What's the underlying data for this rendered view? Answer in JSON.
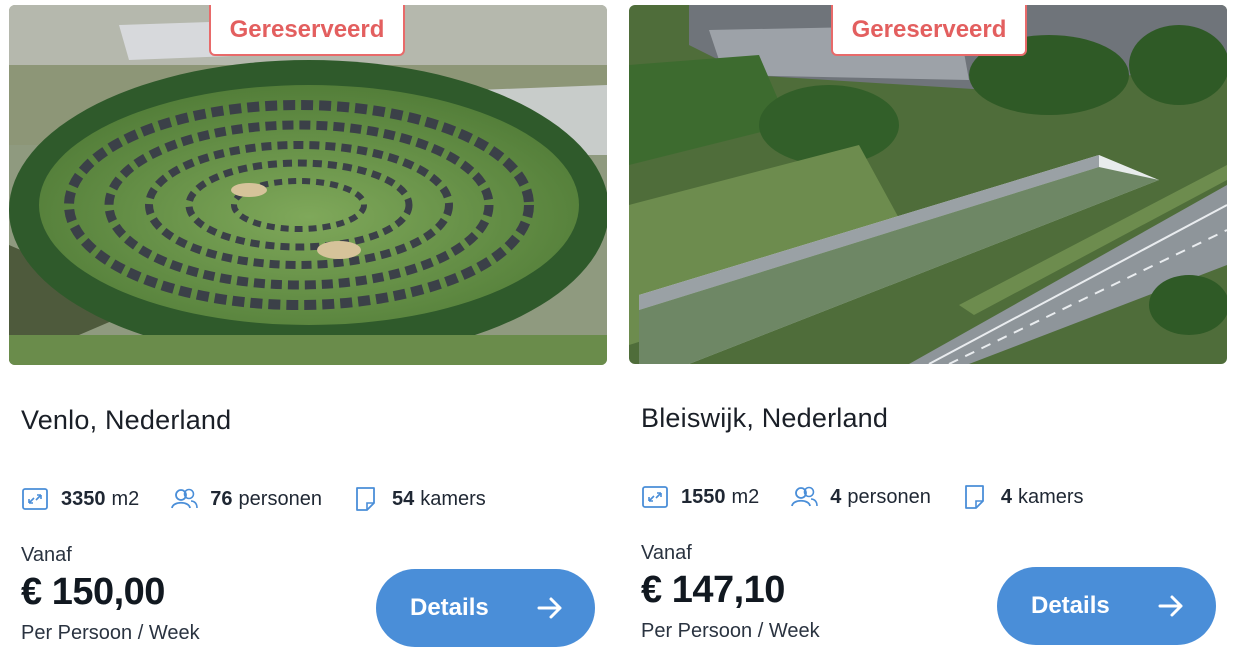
{
  "colors": {
    "accent": "#4a8ed8",
    "badge_red": "#e35f5f",
    "icon_blue": "#4a8ed8"
  },
  "listings": [
    {
      "status_badge": "Gereserveerd",
      "location": "Venlo, Nederland",
      "area_value": "3350",
      "area_unit": "m2",
      "persons_value": "76",
      "persons_label": "personen",
      "rooms_value": "54",
      "rooms_label": "kamers",
      "price_prefix": "Vanaf",
      "price": "€ 150,00",
      "price_period": "Per Persoon / Week",
      "details_label": "Details",
      "icons": [
        "expand-area-icon",
        "people-icon",
        "door-icon",
        "arrow-right-icon"
      ]
    },
    {
      "status_badge": "Gereserveerd",
      "location": "Bleiswijk, Nederland",
      "area_value": "1550",
      "area_unit": "m2",
      "persons_value": "4",
      "persons_label": "personen",
      "rooms_value": "4",
      "rooms_label": "kamers",
      "price_prefix": "Vanaf",
      "price": "€ 147,10",
      "price_period": "Per Persoon / Week",
      "details_label": "Details",
      "icons": [
        "expand-area-icon",
        "people-icon",
        "door-icon",
        "arrow-right-icon"
      ]
    }
  ]
}
